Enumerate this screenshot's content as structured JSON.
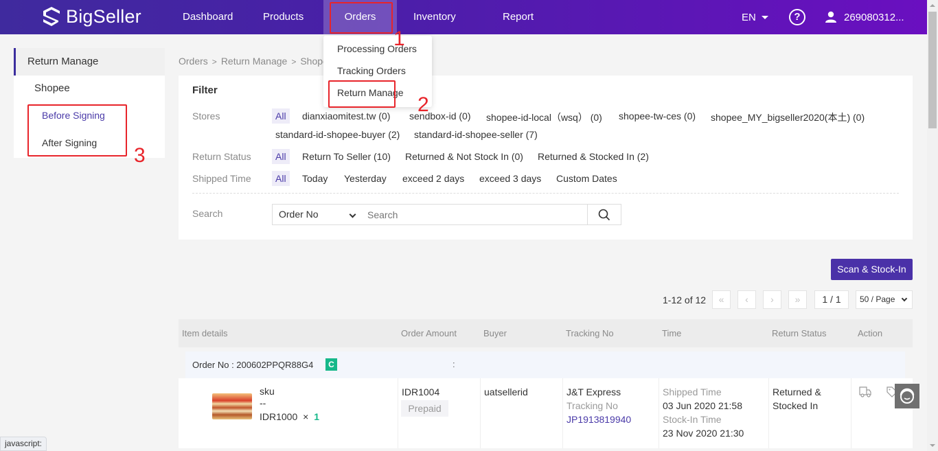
{
  "topnav": {
    "brand": "BigSeller",
    "items": [
      {
        "label": "Dashboard"
      },
      {
        "label": "Products"
      },
      {
        "label": "Orders",
        "active": true
      },
      {
        "label": "Inventory"
      },
      {
        "label": "Report"
      }
    ],
    "language": "EN",
    "help_icon": "question-circle-icon",
    "user_icon": "user-icon",
    "username": "269080312..."
  },
  "orders_menu": {
    "items": [
      {
        "label": "Processing Orders"
      },
      {
        "label": "Tracking Orders"
      },
      {
        "label": "Return Manage"
      }
    ]
  },
  "annotations": [
    "1",
    "2",
    "3"
  ],
  "sidebar": {
    "title": "Return Manage",
    "group": "Shopee",
    "items": [
      {
        "label": "Before Signing",
        "active": true
      },
      {
        "label": "After Signing"
      }
    ]
  },
  "breadcrumb": [
    "Orders",
    "Return Manage",
    "Shopee"
  ],
  "breadcrumb_sep": ">",
  "filter": {
    "title": "Filter",
    "stores": {
      "label": "Stores",
      "options": [
        "All",
        "dianxiaomitest.tw (0)",
        "sendbox-id (0)",
        "shopee-id-local（wsq） (0)",
        "shopee-tw-ces (0)",
        "shopee_MY_bigseller2020(本土) (0)",
        "standard-id-shopee-buyer (2)",
        "standard-id-shopee-seller (7)"
      ]
    },
    "return_status": {
      "label": "Return Status",
      "options": [
        "All",
        "Return To Seller (10)",
        "Returned & Not Stock In (0)",
        "Returned & Stocked In (2)"
      ]
    },
    "shipped_time": {
      "label": "Shipped Time",
      "options": [
        "All",
        "Today",
        "Yesterday",
        "exceed 2 days",
        "exceed 3 days",
        "Custom Dates"
      ]
    },
    "search": {
      "label": "Search",
      "field_selected": "Order No",
      "placeholder": "Search",
      "value": ""
    }
  },
  "actions": {
    "scan_stock_in": "Scan & Stock-In"
  },
  "pagination": {
    "range": "1-12 of 12",
    "first": "«",
    "prev": "‹",
    "next": "›",
    "last": "»",
    "current": "1 / 1",
    "page_size": "50 / Page"
  },
  "table": {
    "columns": [
      "Item details",
      "Order Amount",
      "Buyer",
      "Tracking No",
      "Time",
      "Return Status",
      "Action"
    ],
    "orders": [
      {
        "order_no": "Order No : 200602PPQR88G4",
        "badge": "C",
        "colon": ":",
        "sku": "sku",
        "variant": "--",
        "price": "IDR1000",
        "times": "×",
        "qty": "1",
        "amount": "IDR1004",
        "payment": "Prepaid",
        "buyer": "uatsellerid",
        "carrier": "J&T Express",
        "tracking_label": "Tracking No",
        "tracking_no": "JP1913819940",
        "shipped_label": "Shipped Time",
        "shipped_time": "03 Jun 2020 21:58",
        "stockin_label": "Stock-In Time",
        "stockin_time": "23 Nov 2020 21:30",
        "status_line1": "Returned &",
        "status_line2": "Stocked In",
        "action_icons": [
          "truck-icon",
          "tag-icon"
        ]
      }
    ]
  },
  "statusbar": "javascript:"
}
